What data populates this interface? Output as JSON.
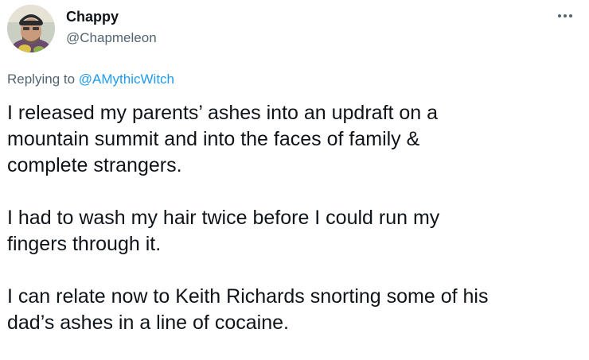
{
  "author": {
    "name": "Chappy",
    "handle": "@Chapmeleon",
    "avatar_icon": "user-avatar-photo"
  },
  "menu": {
    "icon": "more-options-icon"
  },
  "reply": {
    "prefix": "Replying to ",
    "mention": "@AMythicWitch"
  },
  "tweet": {
    "paragraphs": [
      {
        "lines": [
          "I released my parents’ ashes into an updraft on a",
          "mountain summit and into the faces of family &",
          "complete strangers."
        ]
      },
      {
        "lines": [
          "I had to wash my hair twice before I could run my",
          "fingers through it."
        ]
      },
      {
        "lines": [
          "I can relate now to Keith Richards snorting some of his",
          "dad’s ashes in a line of cocaine."
        ]
      }
    ]
  },
  "colors": {
    "text_primary": "#0f1419",
    "text_secondary": "#536471",
    "link": "#1d9bf0",
    "background": "#ffffff"
  }
}
